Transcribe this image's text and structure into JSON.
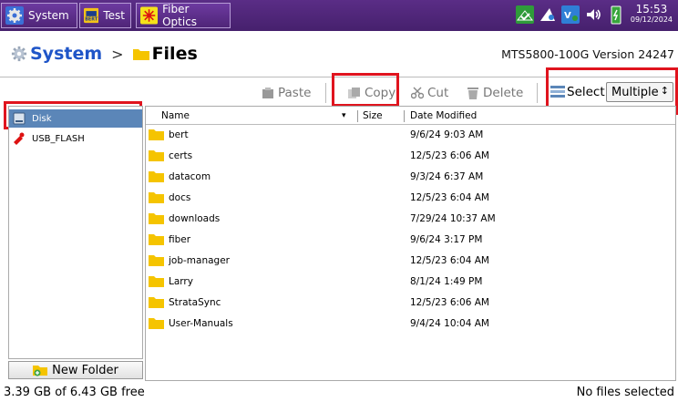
{
  "topbar": {
    "apps": [
      {
        "label": "System",
        "icon": "gear-icon"
      },
      {
        "label": "Test",
        "icon": "bert-icon",
        "icon_text": "BERT"
      },
      {
        "label": "Fiber Optics",
        "icon": "fiber-optics-icon"
      }
    ],
    "status_icons": [
      "network-check-icon",
      "remote-icon",
      "vnc-icon",
      "speaker-icon",
      "battery-charging-icon"
    ],
    "time": "15:53",
    "date": "09/12/2024"
  },
  "breadcrumb": {
    "root": "System",
    "separator": ">",
    "current": "Files"
  },
  "version": "MTS5800-100G Version 24247",
  "toolbar": {
    "paste": "Paste",
    "copy": "Copy",
    "cut": "Cut",
    "delete": "Delete",
    "select_label": "Select",
    "select_value": "Multiple",
    "select_arrow": "↕"
  },
  "drives": [
    {
      "label": "Disk",
      "selected": true,
      "icon": "disk-icon"
    },
    {
      "label": "USB_FLASH",
      "selected": false,
      "icon": "usb-flash-icon"
    }
  ],
  "new_folder": "New Folder",
  "table": {
    "columns": {
      "name": "Name",
      "sort_indicator": "▾",
      "size": "Size",
      "date": "Date Modified"
    },
    "rows": [
      {
        "name": "bert",
        "size": "",
        "date": "9/6/24 9:03 AM"
      },
      {
        "name": "certs",
        "size": "",
        "date": "12/5/23 6:06 AM"
      },
      {
        "name": "datacom",
        "size": "",
        "date": "9/3/24 6:37 AM"
      },
      {
        "name": "docs",
        "size": "",
        "date": "12/5/23 6:04 AM"
      },
      {
        "name": "downloads",
        "size": "",
        "date": "7/29/24 10:37 AM"
      },
      {
        "name": "fiber",
        "size": "",
        "date": "9/6/24 3:17 PM"
      },
      {
        "name": "job-manager",
        "size": "",
        "date": "12/5/23 6:04 AM"
      },
      {
        "name": "Larry",
        "size": "",
        "date": "8/1/24 1:49 PM"
      },
      {
        "name": "StrataSync",
        "size": "",
        "date": "12/5/23 6:06 AM"
      },
      {
        "name": "User-Manuals",
        "size": "",
        "date": "9/4/24 10:04 AM"
      }
    ]
  },
  "footer": {
    "free_space": "3.39 GB of 6.43 GB free",
    "selection": "No files selected"
  },
  "colors": {
    "topbar": "#4f2578",
    "accent": "#1f55c8",
    "selected_drive": "#5b86b8",
    "highlight": "#e0141e",
    "folder": "#f5c400"
  }
}
